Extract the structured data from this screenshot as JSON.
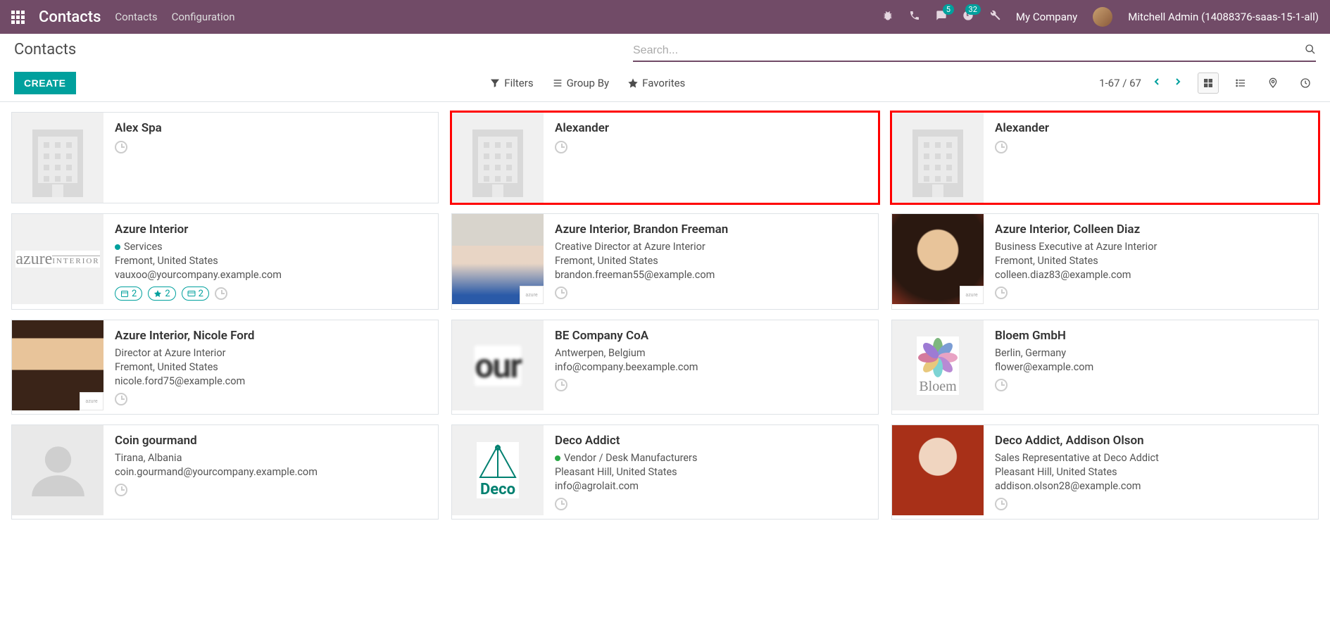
{
  "navbar": {
    "brand": "Contacts",
    "links": [
      "Contacts",
      "Configuration"
    ],
    "badge_chat": "5",
    "badge_clock": "32",
    "company": "My Company",
    "user": "Mitchell Admin (14088376-saas-15-1-all)"
  },
  "breadcrumb": "Contacts",
  "search": {
    "placeholder": "Search..."
  },
  "buttons": {
    "create": "CREATE"
  },
  "filters": {
    "filters": "Filters",
    "groupby": "Group By",
    "favorites": "Favorites"
  },
  "pager": {
    "range": "1-67 / 67"
  },
  "cards": [
    {
      "name": "Alex Spa",
      "type": "company"
    },
    {
      "name": "Alexander",
      "type": "company",
      "highlight": true
    },
    {
      "name": "Alexander",
      "type": "company",
      "highlight": true
    },
    {
      "name": "Azure Interior",
      "type": "azure",
      "tag": "Services",
      "tagColor": "teal",
      "loc": "Fremont, United States",
      "email": "vauxoo@yourcompany.example.com",
      "chips": [
        {
          "icon": "cal",
          "n": "2"
        },
        {
          "icon": "star",
          "n": "2"
        },
        {
          "icon": "card",
          "n": "2"
        }
      ]
    },
    {
      "name": "Azure Interior, Brandon Freeman",
      "type": "brandon",
      "sublogo": true,
      "role": "Creative Director at Azure Interior",
      "loc": "Fremont, United States",
      "email": "brandon.freeman55@example.com"
    },
    {
      "name": "Azure Interior, Colleen Diaz",
      "type": "colleen",
      "sublogo": true,
      "role": "Business Executive at Azure Interior",
      "loc": "Fremont, United States",
      "email": "colleen.diaz83@example.com"
    },
    {
      "name": "Azure Interior, Nicole Ford",
      "type": "nicole",
      "sublogo": true,
      "role": "Director at Azure Interior",
      "loc": "Fremont, United States",
      "email": "nicole.ford75@example.com"
    },
    {
      "name": "BE Company CoA",
      "type": "beco",
      "loc": "Antwerpen, Belgium",
      "email": "info@company.beexample.com"
    },
    {
      "name": "Bloem GmbH",
      "type": "bloem",
      "loc": "Berlin, Germany",
      "email": "flower@example.com"
    },
    {
      "name": "Coin gourmand",
      "type": "person",
      "loc": "Tirana, Albania",
      "email": "coin.gourmand@yourcompany.example.com"
    },
    {
      "name": "Deco Addict",
      "type": "deco",
      "tag": "Vendor / Desk Manufacturers",
      "tagColor": "green",
      "loc": "Pleasant Hill, United States",
      "email": "info@agrolait.com"
    },
    {
      "name": "Deco Addict, Addison Olson",
      "type": "addison",
      "role": "Sales Representative at Deco Addict",
      "loc": "Pleasant Hill, United States",
      "email": "addison.olson28@example.com"
    }
  ]
}
